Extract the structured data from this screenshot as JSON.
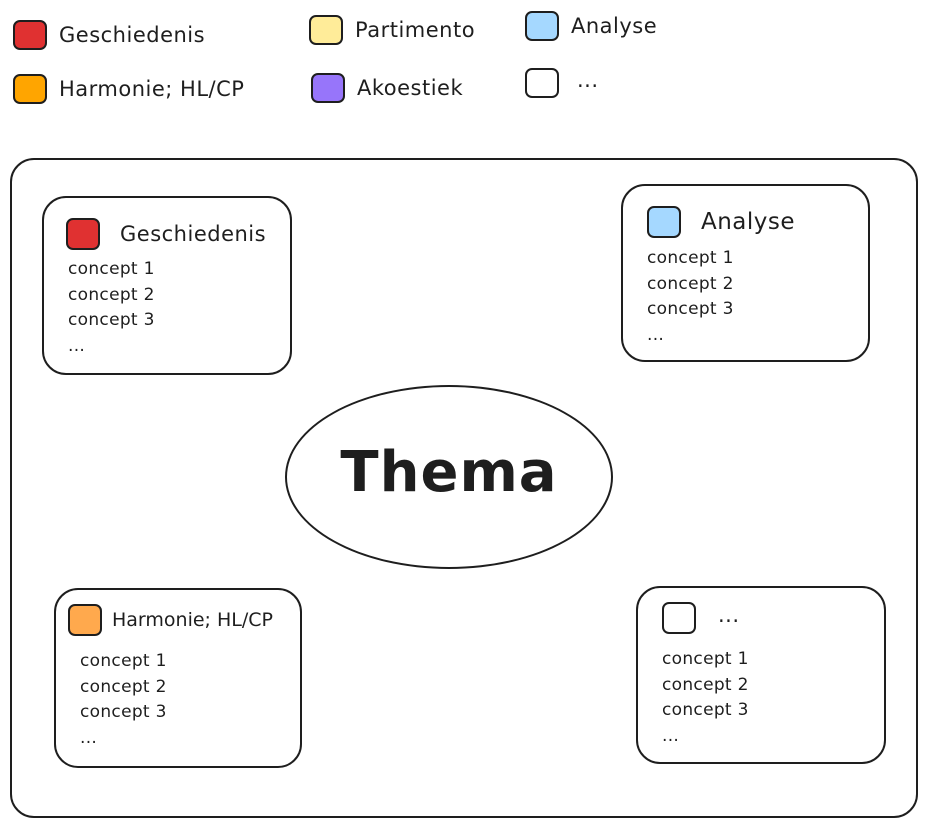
{
  "legend": [
    {
      "label": "Geschiedenis",
      "color": "#e03131"
    },
    {
      "label": "Partimento",
      "color": "#ffec99"
    },
    {
      "label": "Analyse",
      "color": "#a5d8ff"
    },
    {
      "label": "Harmonie; HL/CP",
      "color": "#ffa500"
    },
    {
      "label": "Akoestiek",
      "color": "#9775fa"
    },
    {
      "label": "...",
      "color": "#ffffff"
    }
  ],
  "center": {
    "label": "Thema"
  },
  "cards": [
    {
      "title": "Geschiedenis",
      "color": "#e03131",
      "concepts": [
        "concept 1",
        "concept 2",
        "concept 3",
        "..."
      ]
    },
    {
      "title": "Analyse",
      "color": "#a5d8ff",
      "concepts": [
        "concept 1",
        "concept 2",
        "concept 3",
        "..."
      ]
    },
    {
      "title": "Harmonie; HL/CP",
      "color": "#ffa94d",
      "concepts": [
        "concept 1",
        "concept 2",
        "concept 3",
        "..."
      ]
    },
    {
      "title": "...",
      "color": "#ffffff",
      "concepts": [
        "concept 1",
        "concept 2",
        "concept 3",
        "..."
      ]
    }
  ]
}
